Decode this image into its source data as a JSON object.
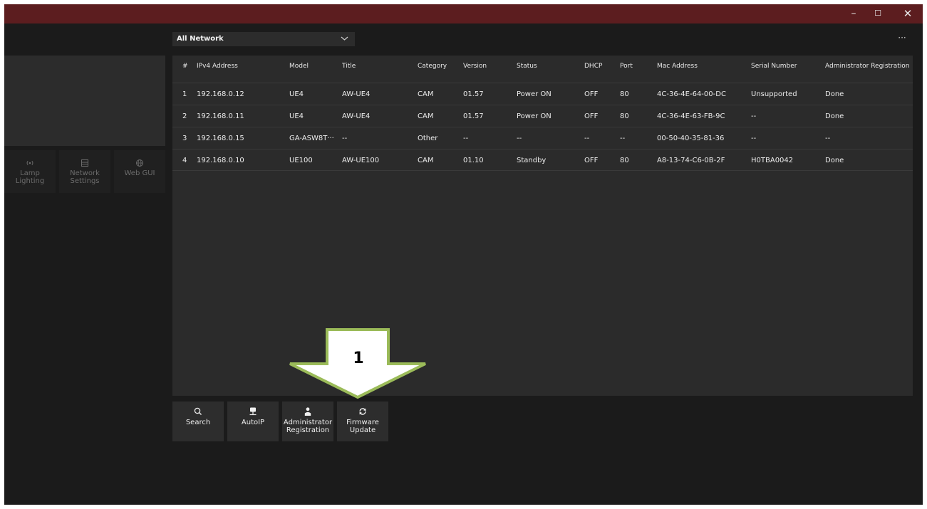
{
  "window": {
    "controls": {
      "minimize": "–",
      "maximize": "☐",
      "close": "✕"
    }
  },
  "toolbar": {
    "network_select": "All Network",
    "more": "···"
  },
  "sidebar": {
    "tools": [
      {
        "icon": "broadcast-icon",
        "label_line1": "Lamp",
        "label_line2": "Lighting"
      },
      {
        "icon": "network-settings-icon",
        "label_line1": "Network",
        "label_line2": "Settings"
      },
      {
        "icon": "globe-icon",
        "label_line1": "Web GUI",
        "label_line2": ""
      }
    ]
  },
  "table": {
    "headers": [
      "#",
      "IPv4 Address",
      "Model",
      "Title",
      "Category",
      "Version",
      "Status",
      "DHCP",
      "Port",
      "Mac Address",
      "Serial Number",
      "Administrator Registration"
    ],
    "rows": [
      [
        "1",
        "192.168.0.12",
        "UE4",
        "AW-UE4",
        "CAM",
        "01.57",
        "Power ON",
        "OFF",
        "80",
        "4C-36-4E-64-00-DC",
        "Unsupported",
        "Done"
      ],
      [
        "2",
        "192.168.0.11",
        "UE4",
        "AW-UE4",
        "CAM",
        "01.57",
        "Power ON",
        "OFF",
        "80",
        "4C-36-4E-63-FB-9C",
        "--",
        "Done"
      ],
      [
        "3",
        "192.168.0.15",
        "GA-ASW8T···",
        "--",
        "Other",
        "--",
        "--",
        "--",
        "--",
        "00-50-40-35-81-36",
        "--",
        "--"
      ],
      [
        "4",
        "192.168.0.10",
        "UE100",
        "AW-UE100",
        "CAM",
        "01.10",
        "Standby",
        "OFF",
        "80",
        "A8-13-74-C6-0B-2F",
        "H0TBA0042",
        "Done"
      ]
    ]
  },
  "bottom_tools": [
    {
      "icon": "search-icon",
      "label_line1": "Search",
      "label_line2": ""
    },
    {
      "icon": "auto-ip-icon",
      "label_line1": "AutoIP",
      "label_line2": ""
    },
    {
      "icon": "user-icon",
      "label_line1": "Administrator",
      "label_line2": "Registration"
    },
    {
      "icon": "refresh-icon",
      "label_line1": "Firmware",
      "label_line2": "Update"
    }
  ],
  "callout": {
    "number": "1",
    "fill_color": "#ffffff",
    "outline_color": "#9bbb59"
  },
  "colors": {
    "titlebar": "#5c1d1f",
    "window_bg": "#1b1b1b",
    "table_bg": "#2b2b2b"
  }
}
